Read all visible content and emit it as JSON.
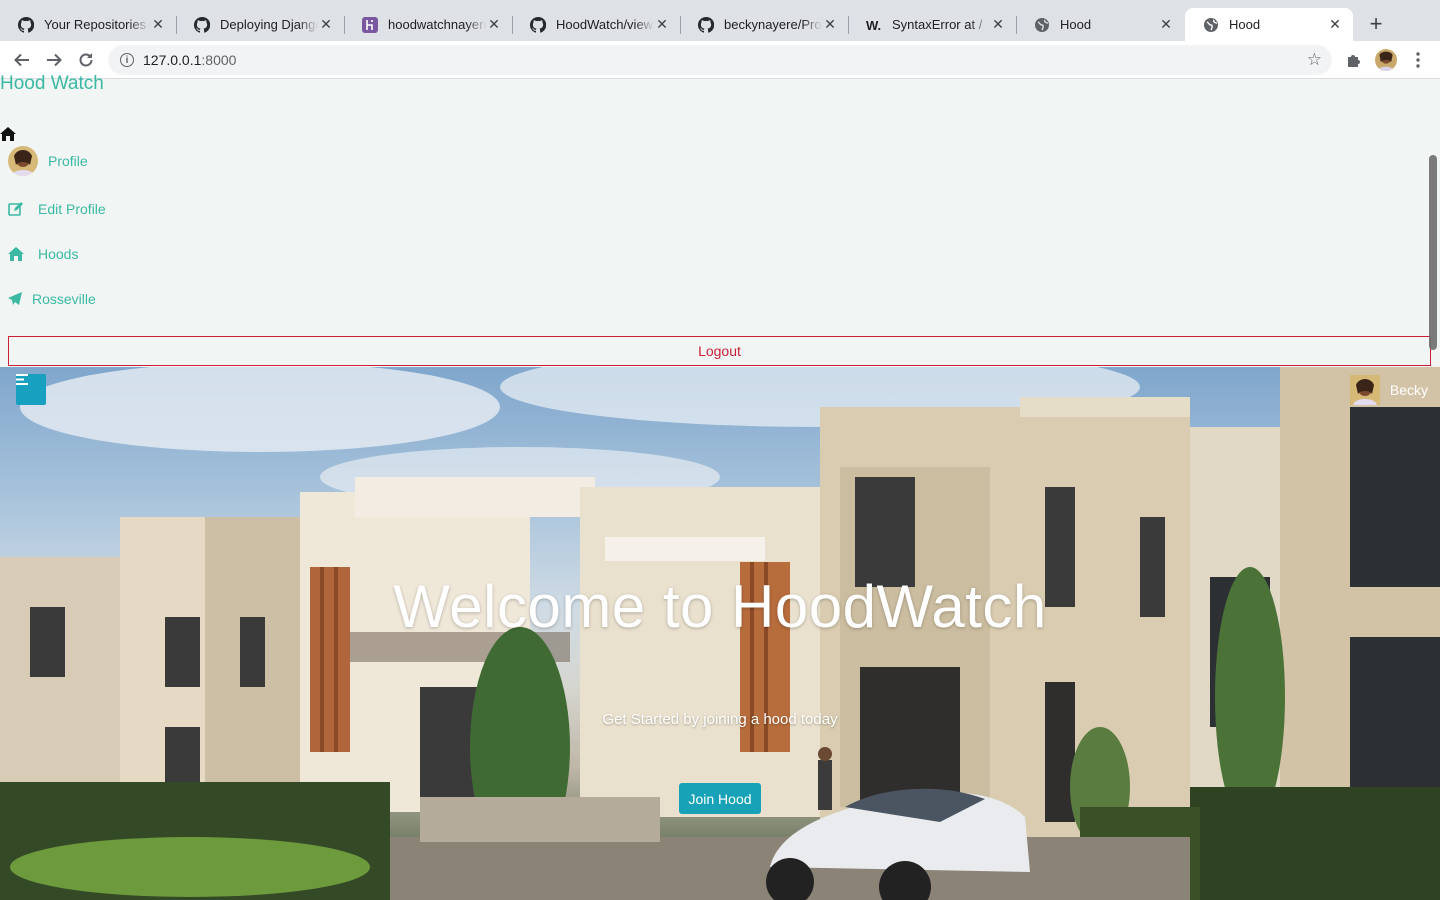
{
  "browser": {
    "tabs": [
      {
        "title": "Your Repositories",
        "icon": "github-icon"
      },
      {
        "title": "Deploying Django",
        "icon": "github-icon"
      },
      {
        "title": "hoodwatchnayere",
        "icon": "heroku-icon"
      },
      {
        "title": "HoodWatch/views",
        "icon": "github-icon"
      },
      {
        "title": "beckynayere/Proje",
        "icon": "github-icon"
      },
      {
        "title": "SyntaxError at /",
        "icon": "w-icon"
      },
      {
        "title": "Hood",
        "icon": "globe-icon"
      },
      {
        "title": "Hood",
        "icon": "globe-icon",
        "active": true
      }
    ],
    "url_host": "127.0.0.1",
    "url_port": ":8000",
    "close_glyph": "✕",
    "new_tab_glyph": "+"
  },
  "sidebar": {
    "brand": "Hood Watch",
    "items": [
      {
        "label": "Profile",
        "icon": "avatar"
      },
      {
        "label": "Edit Profile",
        "icon": "edit-icon"
      },
      {
        "label": "Hoods",
        "icon": "home-icon"
      },
      {
        "label": "Rosseville",
        "icon": "paper-plane-icon"
      }
    ],
    "logout_label": "Logout"
  },
  "hero": {
    "user_name": "Becky",
    "title": "Welcome to HoodWatch",
    "subtitle": "Get Started by joining a hood today",
    "cta_label": "Join Hood"
  },
  "colors": {
    "accent": "#3bb9a3",
    "danger": "#cc1f36",
    "button": "#17a2b8"
  }
}
